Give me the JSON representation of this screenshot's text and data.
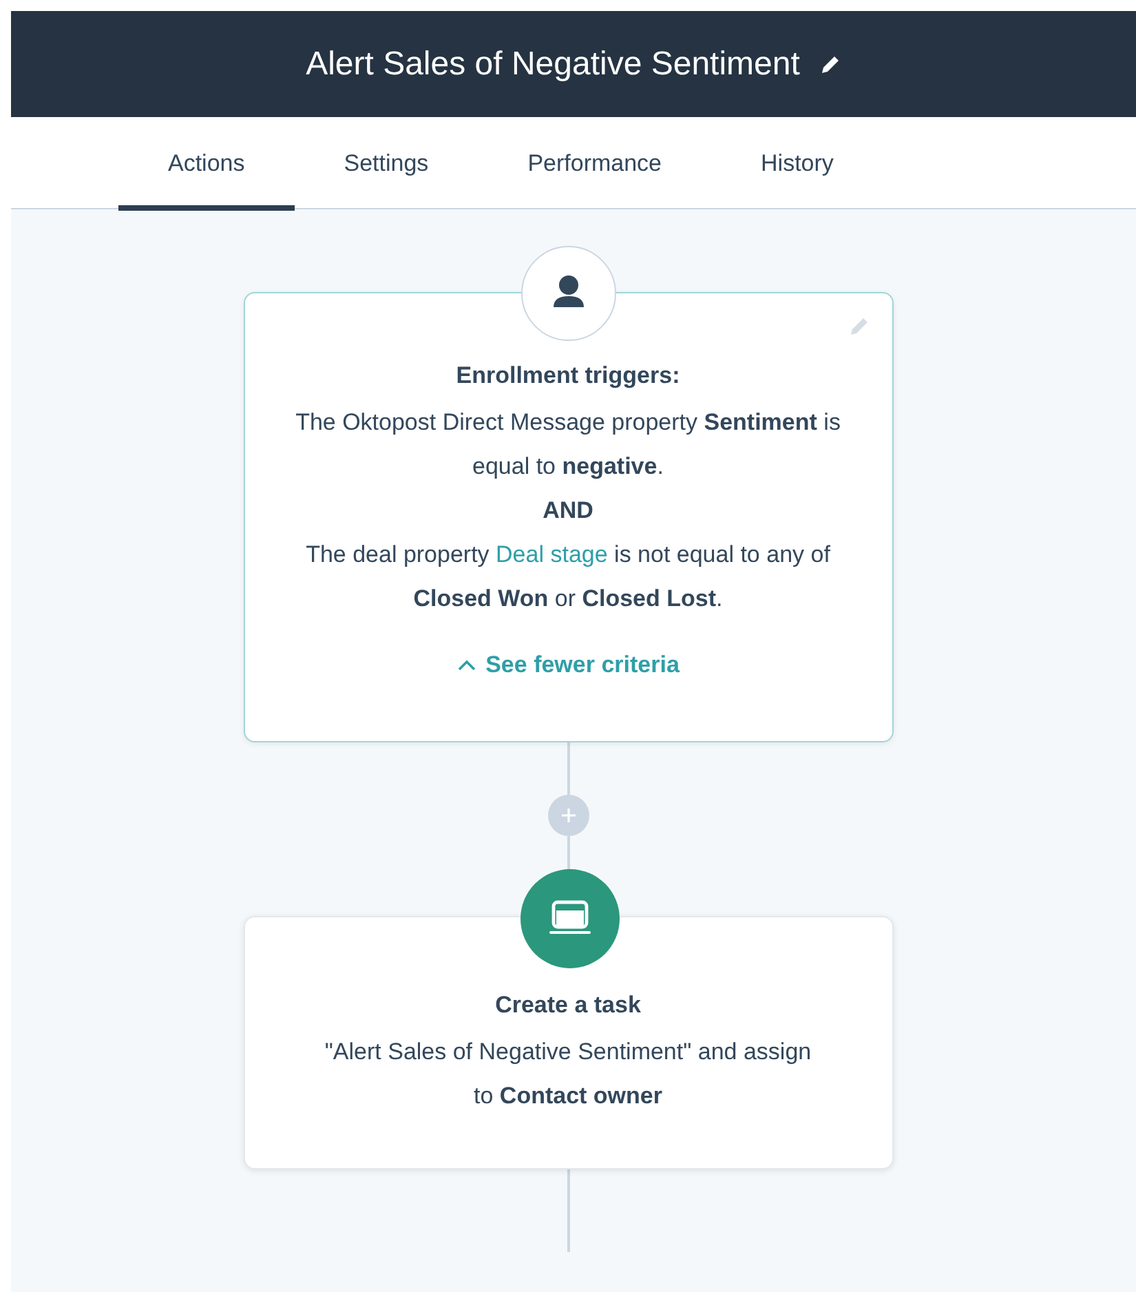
{
  "header": {
    "title": "Alert Sales of Negative Sentiment"
  },
  "tabs": [
    {
      "label": "Actions",
      "selected": true
    },
    {
      "label": "Settings",
      "selected": false
    },
    {
      "label": "Performance",
      "selected": false
    },
    {
      "label": "History",
      "selected": false
    }
  ],
  "steps": [
    {
      "kind": "trigger",
      "heading": "Enrollment triggers:",
      "criteria": [
        {
          "kind": "condition",
          "segments": [
            {
              "kind": "text",
              "text": "The Oktopost Direct Message property **Sentiment** is equal to **negative**."
            }
          ]
        },
        {
          "kind": "joiner",
          "segments": [
            {
              "kind": "text",
              "text": "AND"
            }
          ]
        },
        {
          "kind": "condition",
          "segments": [
            {
              "kind": "text",
              "text": "The deal property "
            },
            {
              "kind": "link",
              "text": "Deal stage"
            },
            {
              "kind": "text",
              "text": " is not equal to any of **Closed Won** or **Closed Lost**."
            }
          ]
        }
      ],
      "toggle": "See fewer criteria"
    },
    {
      "kind": "action",
      "heading": "Create a task",
      "description": "\"Alert Sales of Negative Sentiment\" and assign to **Contact owner**"
    }
  ]
}
